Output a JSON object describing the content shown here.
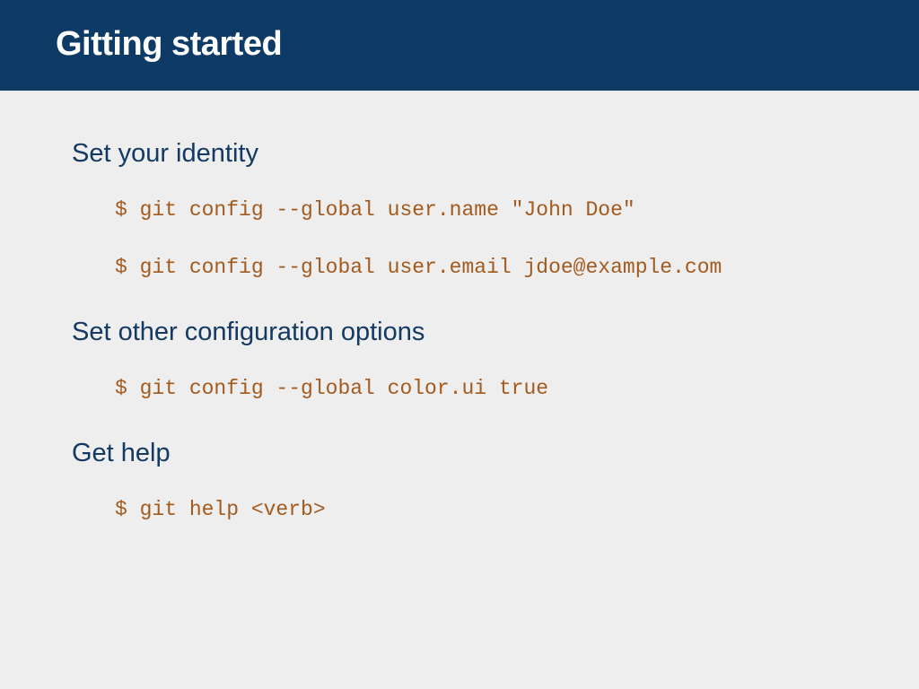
{
  "header": {
    "title": "Gitting started"
  },
  "sections": [
    {
      "heading": "Set your identity",
      "commands": [
        "$ git config --global user.name \"John Doe\"",
        "$ git config --global user.email jdoe@example.com"
      ]
    },
    {
      "heading": "Set other configuration options",
      "commands": [
        "$ git config --global color.ui true"
      ]
    },
    {
      "heading": "Get help",
      "commands": [
        "$ git help <verb>"
      ]
    }
  ]
}
